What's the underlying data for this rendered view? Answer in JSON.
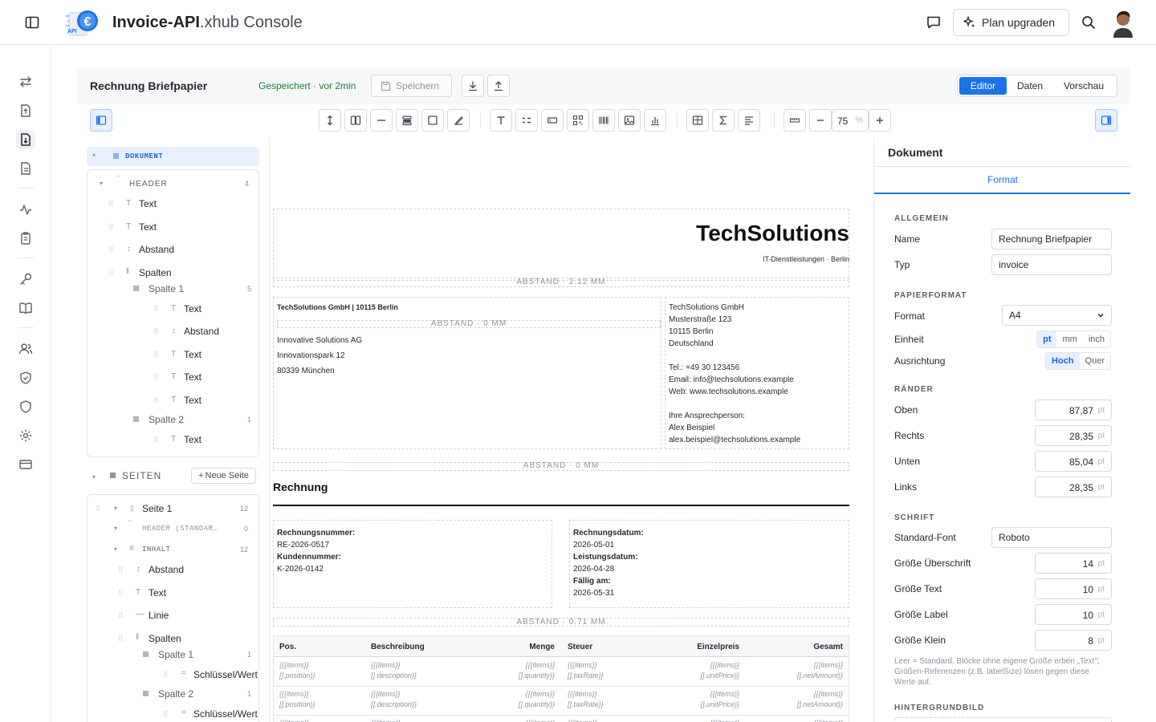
{
  "app": {
    "title_bold": "Invoice-API",
    "title_rest": ".xhub Console",
    "logo_text": "API",
    "upgrade_label": "Plan upgraden"
  },
  "header": {
    "doc_title": "Rechnung Briefpapier",
    "saved_status": "Gespeichert · vor 2min",
    "save_label": "Speichern",
    "views": [
      "Editor",
      "Daten",
      "Vorschau"
    ],
    "active_view": "Editor"
  },
  "toolbar": {
    "zoom": "75",
    "zoom_unit": "%"
  },
  "tree": {
    "document_label": "DOKUMENT",
    "header_label": "HEADER",
    "header_count": "4",
    "header_items": [
      "Text",
      "Text",
      "Abstand",
      "Spalten"
    ],
    "col1_label": "Spalte 1",
    "col1_count": "5",
    "col1_items": [
      "Text",
      "Abstand",
      "Text",
      "Text",
      "Text"
    ],
    "col2_label": "Spalte 2",
    "col2_count": "1",
    "col2_items": [
      "Text"
    ],
    "pages_label": "SEITEN",
    "new_page_label": "Neue Seite",
    "page1_label": "Seite 1",
    "page1_count": "12",
    "page_header_label": "HEADER (STANDAR…",
    "page_header_count": "0",
    "content_label": "INHALT",
    "content_count": "12",
    "content_items": [
      "Abstand",
      "Text",
      "Linie",
      "Spalten"
    ],
    "content_col1_label": "Spalte 1",
    "content_col1_count": "1",
    "content_col1_item": "Schlüssel/Wert",
    "content_col2_label": "Spalte 2",
    "content_col2_count": "1",
    "content_col2_item": "Schlüssel/Wert"
  },
  "page": {
    "company": "TechSolutions",
    "tagline": "IT-Dienstleistungen · Berlin",
    "spacer1": "ABSTAND · 2.12 MM",
    "sender_line": "TechSolutions GmbH | 10115 Berlin",
    "spacer_inner": "ABSTAND · 0 MM",
    "recipient": [
      "Innovative Solutions AG",
      "Innovationspark 12",
      "80339 München"
    ],
    "company_block": [
      "TechSolutions GmbH",
      "Musterstraße 123",
      "10115 Berlin",
      "Deutschland",
      "",
      "Tel.: +49 30 123456",
      "Email: info@techsolutions.example",
      "Web: www.techsolutions.example",
      "",
      "Ihre Ansprechperson:",
      "Alex Beispiel",
      "alex.beispiel@techsolutions.example"
    ],
    "spacer2": "ABSTAND · 0 MM",
    "heading": "Rechnung",
    "meta_left": [
      {
        "label": "Rechnungsnummer:",
        "value": "RE-2026-0517"
      },
      {
        "label": "Kundennummer:",
        "value": "K-2026-0142"
      }
    ],
    "meta_right": [
      {
        "label": "Rechnungsdatum:",
        "value": "2026-05-01"
      },
      {
        "label": "Leistungsdatum:",
        "value": "2026-04-28"
      },
      {
        "label": "Fällig am:",
        "value": "2026-05-31"
      }
    ],
    "spacer3": "ABSTAND · 0.71 MM",
    "table_headers": [
      "Pos.",
      "Beschreibung",
      "Menge",
      "Steuer",
      "Einzelpreis",
      "Gesamt"
    ],
    "table_row": {
      "c1a": "{{{items}}",
      "c1b": "[].position}}",
      "c2a": "{{{items}}",
      "c2b": "[].description}}",
      "c3a": "{{{items}}",
      "c3b": "[].quantity}}",
      "c4a": "{{{items}}",
      "c4b": "[].taxRate}}",
      "c5a": "{{{items}}",
      "c5b": "[].unitPrice}}",
      "c6a": "{{{items}}",
      "c6b": "[].netAmount}}"
    }
  },
  "props": {
    "panel_title": "Dokument",
    "tab": "Format",
    "general_section": "ALLGEMEIN",
    "name_label": "Name",
    "name_value": "Rechnung Briefpapier",
    "type_label": "Typ",
    "type_value": "invoice",
    "paper_section": "PAPIERFORMAT",
    "format_label": "Format",
    "format_value": "A4",
    "unit_label": "Einheit",
    "unit_options": [
      "pt",
      "mm",
      "inch"
    ],
    "orientation_label": "Ausrichtung",
    "orientation_options": [
      "Hoch",
      "Quer"
    ],
    "margins_section": "RÄNDER",
    "margin_top_label": "Oben",
    "margin_top": "87,87",
    "margin_right_label": "Rechts",
    "margin_right": "28,35",
    "margin_bottom_label": "Unten",
    "margin_bottom": "85,04",
    "margin_left_label": "Links",
    "margin_left": "28,35",
    "unit": "pt",
    "font_section": "SCHRIFT",
    "default_font_label": "Standard-Font",
    "default_font": "Roboto",
    "heading_size_label": "Größe Überschrift",
    "heading_size": "14",
    "text_size_label": "Größe Text",
    "text_size": "10",
    "label_size_label": "Größe Label",
    "label_size": "10",
    "small_size_label": "Größe Klein",
    "small_size": "8",
    "hint": "Leer = Standard. Blöcke ohne eigene Größe erben „Text\"; Größen-Referenzen (z.B. labelSize) lösen gegen diese Werte auf.",
    "bg_section": "HINTERGRUNDBILD"
  },
  "colors": {
    "accent": "#1a73e8",
    "saved_green": "#1a7f37"
  }
}
